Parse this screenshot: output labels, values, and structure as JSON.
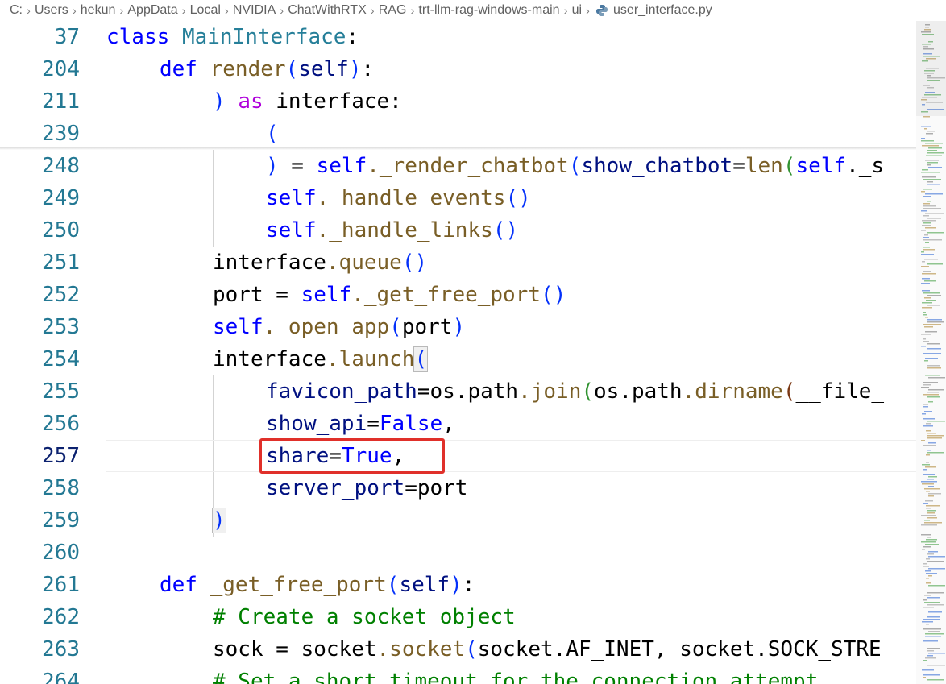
{
  "breadcrumb": {
    "items": [
      "C:",
      "Users",
      "hekun",
      "AppData",
      "Local",
      "NVIDIA",
      "ChatWithRTX",
      "RAG",
      "trt-llm-rag-windows-main",
      "ui"
    ],
    "file": "user_interface.py"
  },
  "lines": {
    "l37": {
      "num": "37",
      "kw": "class",
      "cls": "MainInterface",
      "p": ":"
    },
    "l204": {
      "num": "204",
      "kw": "def",
      "fn": "render",
      "o": "(",
      "self": "self",
      "c": ")",
      "p": ":"
    },
    "l211": {
      "num": "211",
      "c": ")",
      "kw": "as",
      "v": "interface",
      "p": ":"
    },
    "l239": {
      "num": "239",
      "o": "("
    },
    "l248": {
      "num": "248",
      "c": ")",
      "eq": " = ",
      "self": "self",
      "fn": "._render_chatbot",
      "o": "(",
      "arg": "show_chatbot",
      "eq2": "=",
      "fn2": "len",
      "o2": "(",
      "self2": "self",
      "rest": "._s"
    },
    "l249": {
      "num": "249",
      "self": "self",
      "fn": "._handle_events",
      "o": "(",
      "c": ")"
    },
    "l250": {
      "num": "250",
      "self": "self",
      "fn": "._handle_links",
      "o": "(",
      "c": ")"
    },
    "l251": {
      "num": "251",
      "v": "interface",
      "fn": ".queue",
      "o": "(",
      "c": ")"
    },
    "l252": {
      "num": "252",
      "v": "port",
      "eq": " = ",
      "self": "self",
      "fn": "._get_free_port",
      "o": "(",
      "c": ")"
    },
    "l253": {
      "num": "253",
      "self": "self",
      "fn": "._open_app",
      "o": "(",
      "v": "port",
      "c": ")"
    },
    "l254": {
      "num": "254",
      "v": "interface",
      "fn": ".launch",
      "o": "("
    },
    "l255": {
      "num": "255",
      "arg": "favicon_path",
      "eq": "=",
      "v": "os.path",
      "fn": ".join",
      "o": "(",
      "v2": "os.path",
      "fn2": ".dirname",
      "o2": "(",
      "rest": "__file_"
    },
    "l256": {
      "num": "256",
      "arg": "show_api",
      "eq": "=",
      "val": "False",
      "p": ","
    },
    "l257": {
      "num": "257",
      "arg": "share",
      "eq": "=",
      "val": "True",
      "p": ","
    },
    "l258": {
      "num": "258",
      "arg": "server_port",
      "eq": "=",
      "v": "port"
    },
    "l259": {
      "num": "259",
      "c": ")"
    },
    "l260": {
      "num": "260"
    },
    "l261": {
      "num": "261",
      "kw": "def",
      "fn": "_get_free_port",
      "o": "(",
      "self": "self",
      "c": ")",
      "p": ":"
    },
    "l262": {
      "num": "262",
      "cmt": "# Create a socket object"
    },
    "l263": {
      "num": "263",
      "v": "sock",
      "eq": " = ",
      "v2": "socket",
      "fn": ".socket",
      "o": "(",
      "rest": "socket.AF_INET, socket.SOCK_STRE"
    },
    "l264": {
      "num": "264",
      "cmt": "# Set a short timeout for the connection attempt"
    }
  }
}
